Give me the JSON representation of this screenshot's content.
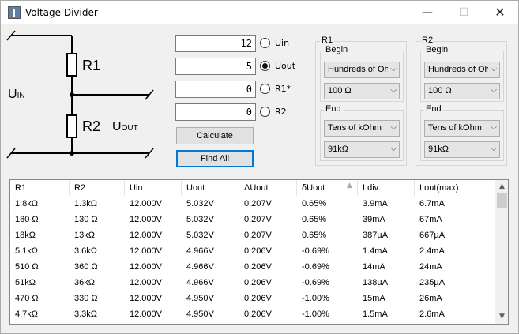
{
  "window": {
    "title": "Voltage Divider"
  },
  "schematic": {
    "r1": "R1",
    "r2": "R2",
    "uin": "U",
    "uin_sub": "IN",
    "uout": "U",
    "uout_sub": "OUT"
  },
  "inputs": [
    {
      "value": "12",
      "label": "Uin",
      "checked": false
    },
    {
      "value": "5",
      "label": "Uout",
      "checked": true
    },
    {
      "value": "0",
      "label": "R1*",
      "checked": false
    },
    {
      "value": "0",
      "label": "R2",
      "checked": false
    }
  ],
  "buttons": {
    "calculate": "Calculate",
    "find_all": "Find All"
  },
  "r1": {
    "title": "R1",
    "begin_title": "Begin",
    "begin_range": "Hundreds of Ohm",
    "begin_value": "100 Ω",
    "end_title": "End",
    "end_range": "Tens of kOhm",
    "end_value": "91kΩ"
  },
  "r2": {
    "title": "R2",
    "begin_title": "Begin",
    "begin_range": "Hundreds of Ohm",
    "begin_value": "100 Ω",
    "end_title": "End",
    "end_range": "Tens of kOhm",
    "end_value": "91kΩ"
  },
  "table": {
    "columns": [
      "R1",
      "R2",
      "Uin",
      "Uout",
      "ΔUout",
      "δUout",
      "I div.",
      "I out(max)"
    ],
    "rows": [
      [
        "1.8kΩ",
        "1.3kΩ",
        "12.000V",
        "5.032V",
        "0.207V",
        "0.65%",
        "3.9mA",
        "6.7mA"
      ],
      [
        "180 Ω",
        "130 Ω",
        "12.000V",
        "5.032V",
        "0.207V",
        "0.65%",
        "39mA",
        "67mA"
      ],
      [
        "18kΩ",
        "13kΩ",
        "12.000V",
        "5.032V",
        "0.207V",
        "0.65%",
        "387µA",
        "667µA"
      ],
      [
        "5.1kΩ",
        "3.6kΩ",
        "12.000V",
        "4.966V",
        "0.206V",
        "-0.69%",
        "1.4mA",
        "2.4mA"
      ],
      [
        "510 Ω",
        "360 Ω",
        "12.000V",
        "4.966V",
        "0.206V",
        "-0.69%",
        "14mA",
        "24mA"
      ],
      [
        "51kΩ",
        "36kΩ",
        "12.000V",
        "4.966V",
        "0.206V",
        "-0.69%",
        "138µA",
        "235µA"
      ],
      [
        "470 Ω",
        "330 Ω",
        "12.000V",
        "4.950V",
        "0.206V",
        "-1.00%",
        "15mA",
        "26mA"
      ],
      [
        "4.7kΩ",
        "3.3kΩ",
        "12.000V",
        "4.950V",
        "0.206V",
        "-1.00%",
        "1.5mA",
        "2.6mA"
      ]
    ]
  }
}
